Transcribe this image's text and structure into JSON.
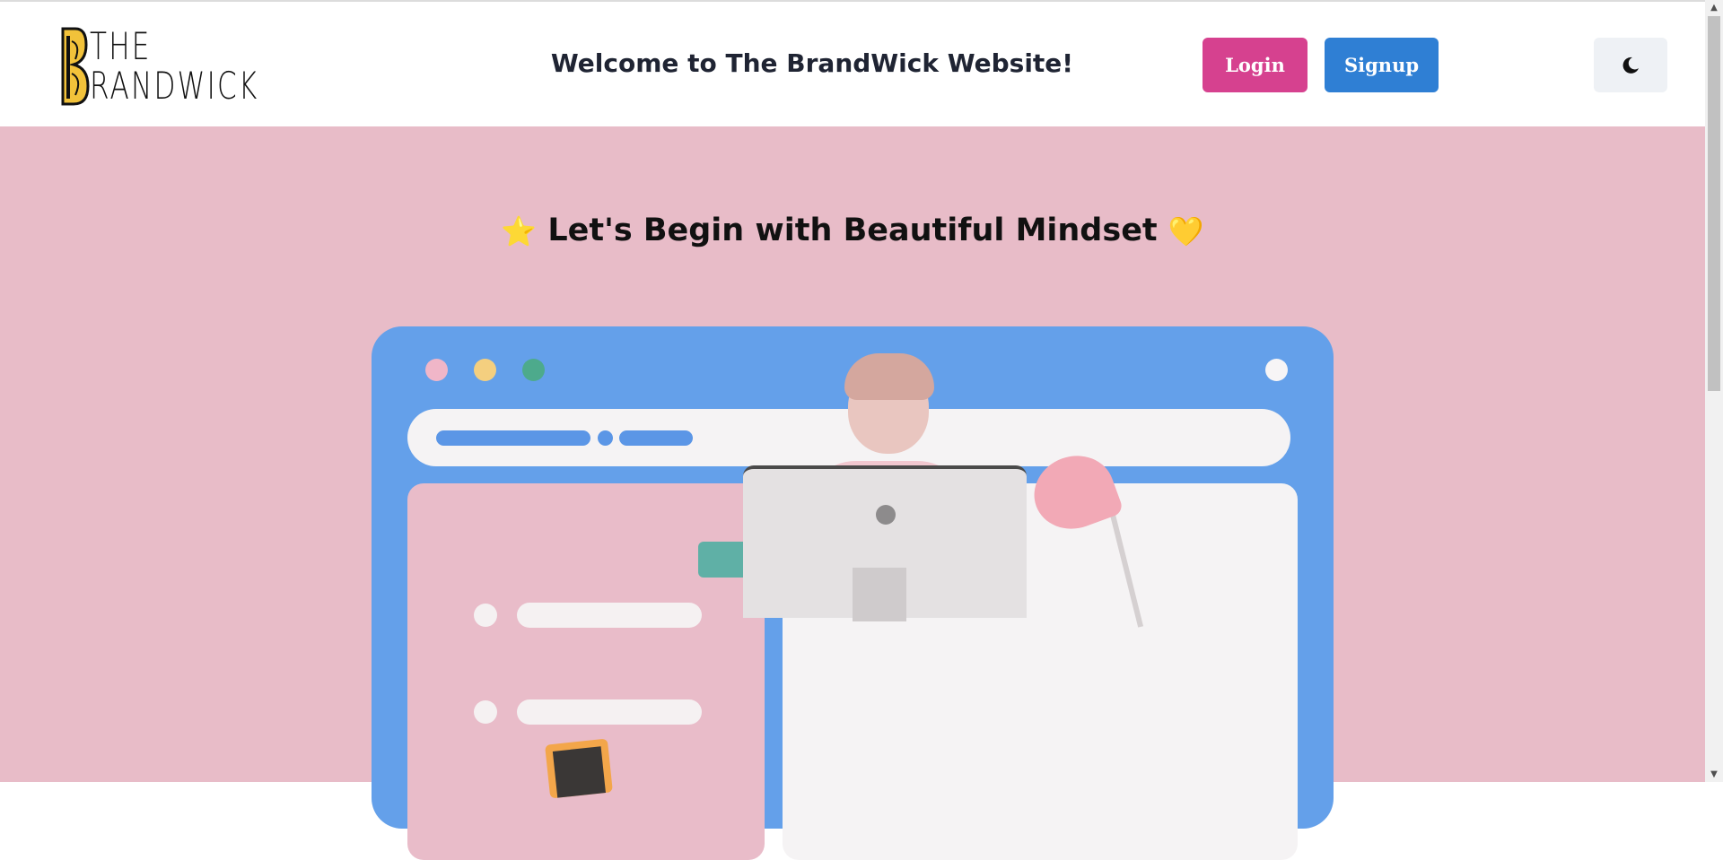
{
  "header": {
    "logo": {
      "line1": "THE",
      "line2": "RANDWICK"
    },
    "welcome_text": "Welcome to The BrandWick Website!",
    "login_label": "Login",
    "signup_label": "Signup",
    "theme_icon": "moon-icon"
  },
  "hero": {
    "title": "Let's Begin with Beautiful Mindset",
    "emoji_left": "⭐",
    "emoji_right": "💛",
    "illustration": "person-at-desk-illustration"
  },
  "colors": {
    "login": "#d6418f",
    "signup": "#2f7fd4",
    "hero_bg": "#e8bcc8",
    "window_blue": "#64a0ea"
  }
}
